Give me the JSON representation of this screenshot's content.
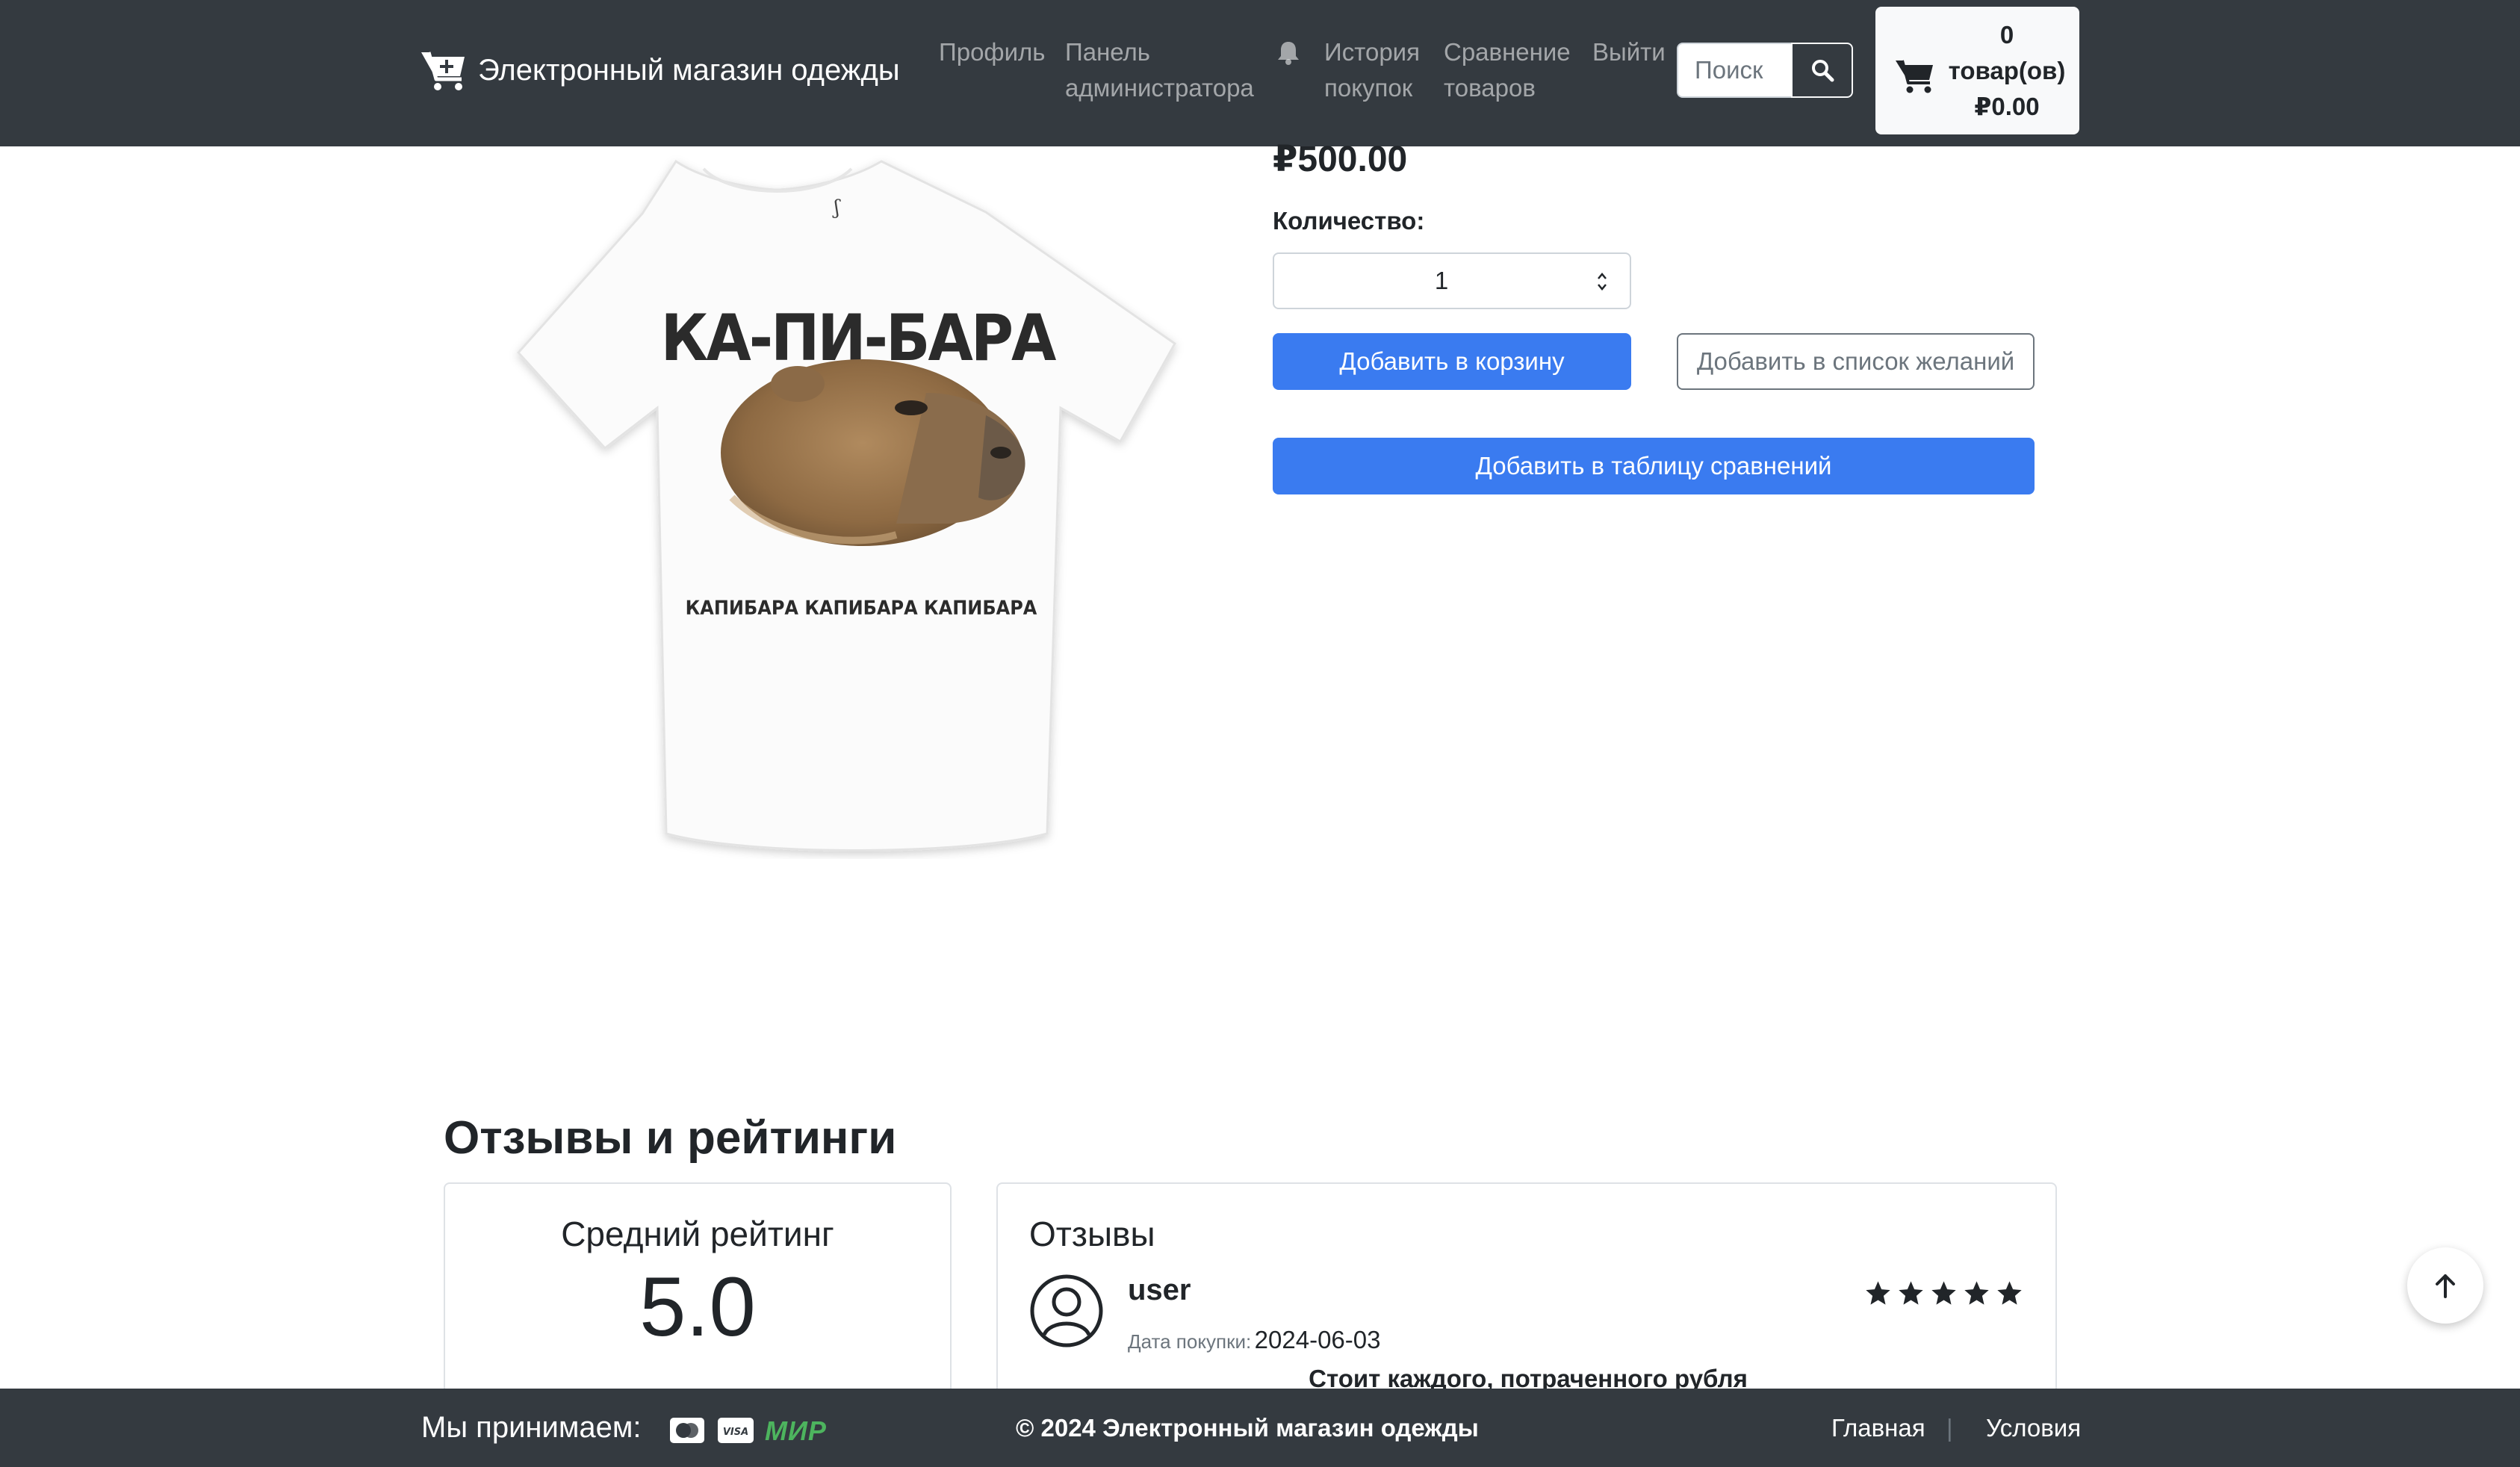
{
  "header": {
    "brand": "Электронный магазин одежды",
    "nav": {
      "profile": "Профиль",
      "admin_line1": "Панель",
      "admin_line2": "администратора",
      "history_line1": "История",
      "history_line2": "покупок",
      "compare_line1": "Сравнение",
      "compare_line2": "товаров",
      "logout": "Выйти"
    },
    "search_placeholder": "Поиск",
    "cart": {
      "count": "0",
      "unit": "товар(ов)",
      "total": "₽0.00"
    }
  },
  "product": {
    "image": {
      "title_print": "КА-ПИ-БАРА",
      "caption_print": "КАПИБАРА КАПИБАРА КАПИБАРА"
    },
    "price": "₽500.00",
    "quantity_label": "Количество:",
    "quantity": "1",
    "add_to_cart": "Добавить в корзину",
    "add_to_wishlist": "Добавить в список желаний",
    "add_to_compare": "Добавить в таблицу сравнений"
  },
  "reviews": {
    "section_title": "Отзывы и рейтинги",
    "average_title": "Средний рейтинг",
    "average_value": "5.0",
    "list_title": "Отзывы",
    "items": [
      {
        "user": "user",
        "date_label": "Дата покупки:",
        "date": "2024-06-03",
        "rating": 5,
        "text": "Стоит каждого, потраченного рубля"
      }
    ]
  },
  "footer": {
    "accept_label": "Мы принимаем:",
    "payments": [
      "mastercard-icon",
      "visa-icon",
      "mir-icon"
    ],
    "mir_text": "МИР",
    "copyright": "© 2024 Электронный магазин одежды",
    "links": {
      "home": "Главная",
      "separator": "|",
      "terms": "Условия"
    }
  },
  "colors": {
    "navbar": "#343a40",
    "primary": "#3a7bf0",
    "outline": "#6c757d",
    "mir_green": "#4db45e"
  }
}
